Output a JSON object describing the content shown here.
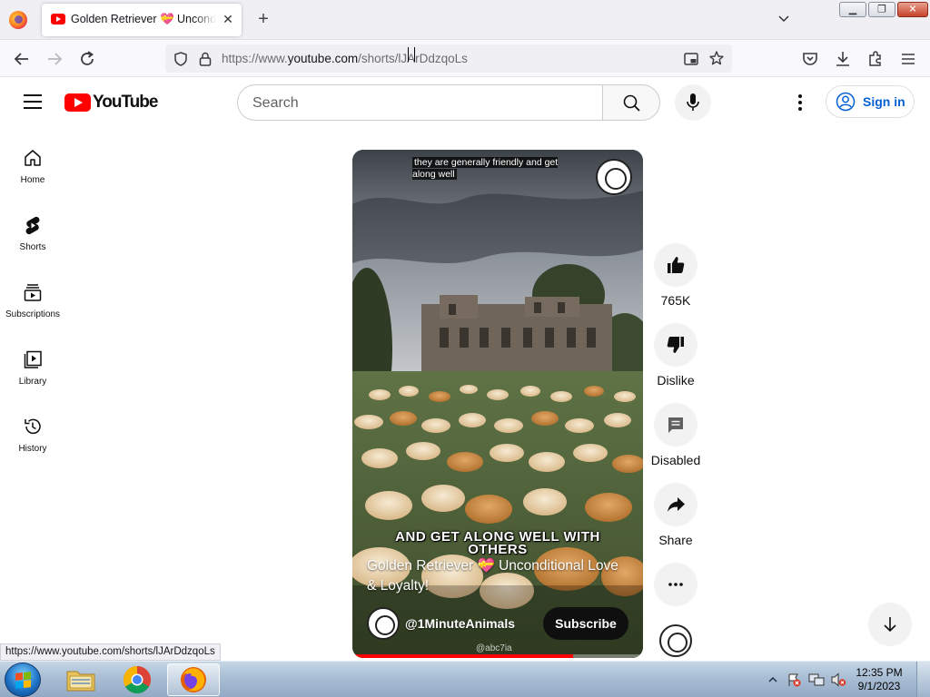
{
  "browser": {
    "tab": {
      "title": "Golden Retriever 💝 Unconditional Love & Loyalty!",
      "close_glyph": "✕"
    },
    "new_tab_glyph": "+",
    "url": {
      "prefix": "https://www.",
      "host": "youtube.com",
      "path": "/shorts/lJArDdzqoLs"
    },
    "status_link": "https://www.youtube.com/shorts/lJArDdzqoLs"
  },
  "youtube": {
    "logo_text": "YouTube",
    "search_placeholder": "Search",
    "sign_in_label": "Sign in",
    "guide": [
      {
        "label": "Home",
        "icon": "home-icon"
      },
      {
        "label": "Shorts",
        "icon": "shorts-icon"
      },
      {
        "label": "Subscriptions",
        "icon": "subscriptions-icon"
      },
      {
        "label": "Library",
        "icon": "library-icon"
      },
      {
        "label": "History",
        "icon": "history-icon"
      }
    ]
  },
  "short": {
    "top_caption": "they are generally friendly and get along well",
    "overlay_caption_line1": "AND GET ALONG WELL WITH",
    "overlay_caption_line2": "OTHERS",
    "title": "Golden Retriever 💝 Unconditional Love & Loyalty!",
    "channel": "@1MinuteAnimals",
    "subscribe_label": "Subscribe",
    "watermark": "@abc7ia",
    "progress": 0.76,
    "actions": [
      {
        "label": "765K",
        "icon": "thumbs-up-icon"
      },
      {
        "label": "Dislike",
        "icon": "thumbs-down-icon"
      },
      {
        "label": "Disabled",
        "icon": "comment-icon"
      },
      {
        "label": "Share",
        "icon": "share-icon"
      },
      {
        "label": "",
        "icon": "more-icon"
      }
    ]
  },
  "taskbar": {
    "apps": [
      "file-explorer-icon",
      "chrome-icon",
      "firefox-icon"
    ],
    "clock_time": "12:35 PM",
    "clock_date": "9/1/2023"
  },
  "colors": {
    "yt_red": "#ff0000",
    "yt_blue": "#065fd4",
    "tab_bar": "#f0f0f4"
  }
}
